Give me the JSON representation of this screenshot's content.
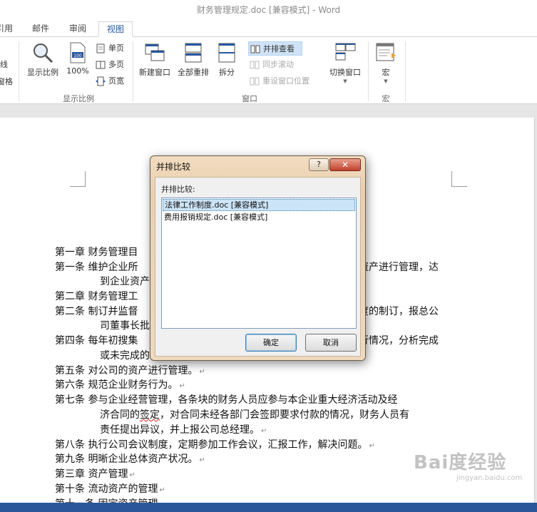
{
  "window": {
    "title": "财务管理规定.doc [兼容模式] - Word"
  },
  "ribbon_tabs": [
    {
      "label": "引用"
    },
    {
      "label": "邮件"
    },
    {
      "label": "审阅"
    },
    {
      "label": "视图",
      "active": true
    }
  ],
  "ribbon": {
    "cut_left_top": "线",
    "cut_left_bottom": "窗格",
    "zoom_group": {
      "label": "显示比例",
      "zoom_button": "显示比例",
      "hundred_button": "100%",
      "hundred_icon_text": "100",
      "one_page": "单页",
      "multi_page": "多页",
      "page_width": "页宽"
    },
    "window_group": {
      "label": "窗口",
      "new_window": "新建窗口",
      "arrange_all": "全部重排",
      "split": "拆分",
      "side_by_side": "并排查看",
      "sync_scroll": "同步滚动",
      "reset_position": "重设窗口位置",
      "switch_windows": "切换窗口"
    },
    "macro_group": {
      "label": "宏",
      "macros": "宏"
    }
  },
  "document": {
    "lines": [
      "第一章  财务管理目",
      "第一条  维护企业所",
      "资产进行管理，达",
      "到企业资产",
      "第二章  财务管理工",
      "第二条  制订并监督",
      "度的制订，报总公",
      "司董事长批",
      "第四条  每年初搜集",
      "行情况，分析完成",
      "或未完成的",
      "第五条  对公司的资产进行管理。",
      "第六条  规范企业财务行为。",
      "第七条  参与企业经营管理，各条块的财务人员应参与本企业重大经济活动及经",
      "济合同的",
      "签定",
      "，对合同未经各部门会签即要求付款的情况，财务人员有",
      "责任提出异议，并上报公司总经理。",
      "第八条  执行公司会议制度，定期参加工作会议，汇报工作，解决问题。",
      "第九条  明晰企业总体资产状况。",
      "第三章  资产管理",
      "第十条  流动资产的管理",
      "第十一条  固定资产管理"
    ]
  },
  "dialog": {
    "title": "并排比较",
    "help_label": "?",
    "close_label": "✕",
    "list_label": "并排比较:",
    "documents": [
      {
        "name": "法律工作制度.doc [兼容模式]",
        "selected": true
      },
      {
        "name": "费用报销规定.doc [兼容模式]",
        "selected": false
      }
    ],
    "ok_button": "确定",
    "cancel_button": "取消"
  },
  "watermark": {
    "brand": "Bai度经验",
    "url": "jingyan.baidu.com"
  },
  "colors": {
    "accent": "#2b579a",
    "statusbar": "#2b579a",
    "selection": "#cce4f7"
  }
}
